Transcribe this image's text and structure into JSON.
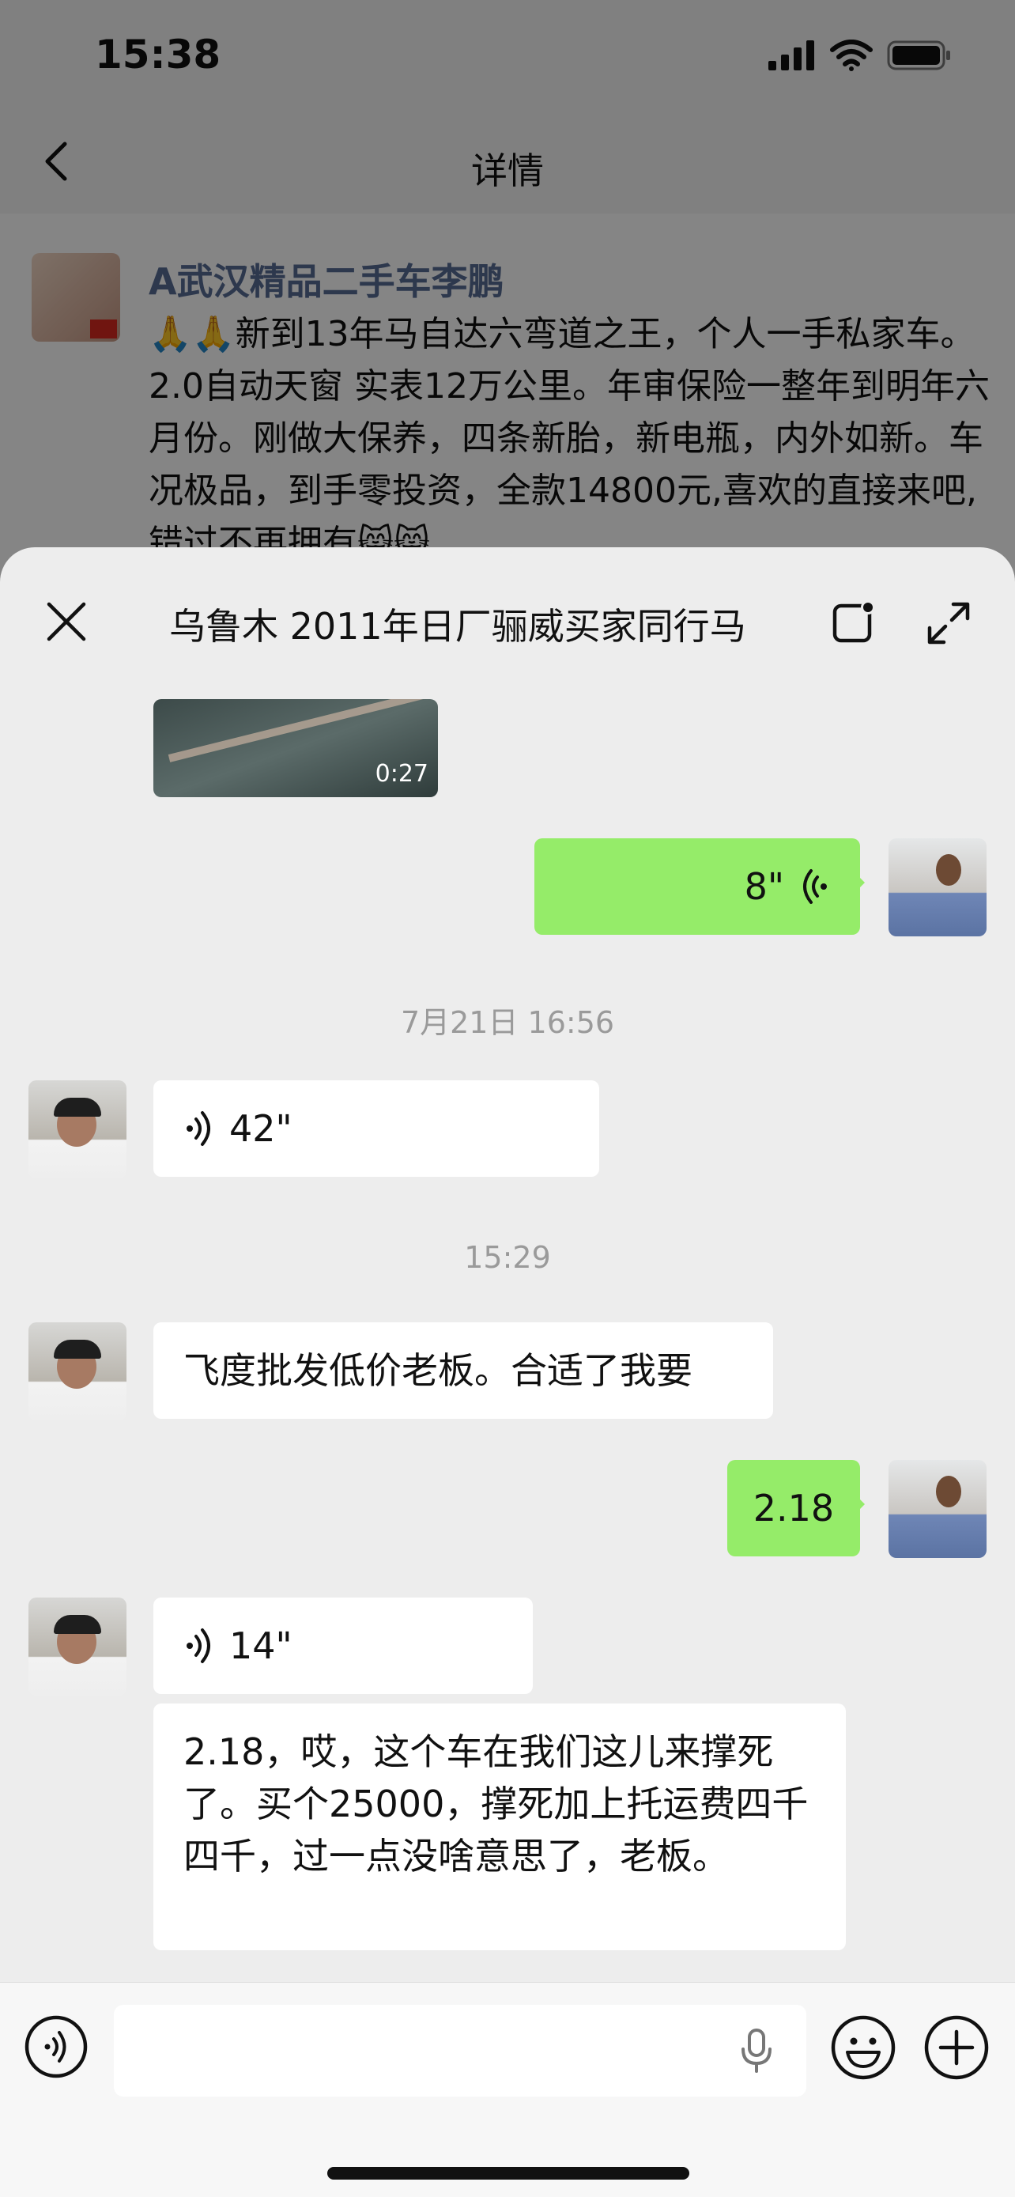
{
  "status": {
    "time": "15:38"
  },
  "nav": {
    "title": "详情"
  },
  "moment": {
    "author": "A武汉精品二手车李鹏",
    "text": "🙏🙏新到13年马自达六弯道之王，个人一手私家车。 2.0自动天窗 实表12万公里。年审保险一整年到明年六月份。刚做大保养，四条新胎，新电瓶，内外如新。车况极品，到手零投资，全款14800元,喜欢的直接来吧,错过不再拥有😸😸"
  },
  "sheet": {
    "title": "乌鲁木 2011年日厂骊威买家同行马",
    "video": {
      "duration": "0:27"
    },
    "messages": [
      {
        "type": "voice",
        "side": "right",
        "duration": "8\""
      },
      {
        "type": "timestamp",
        "text": "7月21日 16:56"
      },
      {
        "type": "voice",
        "side": "left",
        "duration": "42\""
      },
      {
        "type": "timestamp",
        "text": "15:29"
      },
      {
        "type": "text",
        "side": "left",
        "text": "飞度批发低价老板。合适了我要"
      },
      {
        "type": "text",
        "side": "right",
        "text": "2.18"
      },
      {
        "type": "voice",
        "side": "left",
        "duration": "14\""
      },
      {
        "type": "text",
        "side": "left",
        "text": "2.18，哎，这个车在我们这儿来撑死了。买个25000，撑死加上托运费四千四千，过一点没啥意思了，老板。"
      }
    ]
  },
  "colors": {
    "bubble_me": "#95ec69",
    "bubble_them": "#ffffff",
    "link_name": "#576b95"
  }
}
